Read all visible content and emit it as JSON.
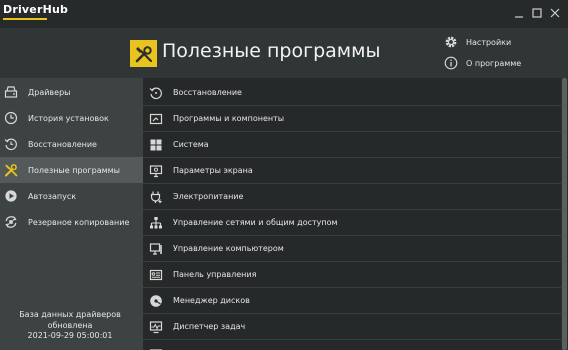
{
  "app": {
    "title": "DriverHub"
  },
  "header": {
    "title": "Полезные программы",
    "settings_label": "Настройки",
    "about_label": "О программе"
  },
  "sidebar": {
    "items": [
      {
        "label": "Драйверы",
        "icon": "driver-icon"
      },
      {
        "label": "История установок",
        "icon": "history-icon"
      },
      {
        "label": "Восстановление",
        "icon": "restore-icon"
      },
      {
        "label": "Полезные программы",
        "icon": "tools-icon",
        "active": true
      },
      {
        "label": "Автозапуск",
        "icon": "autorun-icon"
      },
      {
        "label": "Резервное копирование",
        "icon": "backup-icon"
      }
    ],
    "status": {
      "line1": "База данных драйверов",
      "line2": "обновлена",
      "timestamp": "2021-09-29 05:00:01"
    }
  },
  "main": {
    "items": [
      {
        "label": "Восстановление",
        "icon": "restore-icon"
      },
      {
        "label": "Программы и компоненты",
        "icon": "programs-icon"
      },
      {
        "label": "Система",
        "icon": "windows-icon"
      },
      {
        "label": "Параметры экрана",
        "icon": "display-icon"
      },
      {
        "label": "Электропитание",
        "icon": "power-icon"
      },
      {
        "label": "Управление сетями и общим доступом",
        "icon": "network-icon"
      },
      {
        "label": "Управление компьютером",
        "icon": "computer-icon"
      },
      {
        "label": "Панель управления",
        "icon": "control-panel-icon"
      },
      {
        "label": "Менеджер дисков",
        "icon": "disk-icon"
      },
      {
        "label": "Диспетчер задач",
        "icon": "task-manager-icon"
      }
    ]
  },
  "colors": {
    "accent": "#e9c31e",
    "sidebar_bg": "#3d4242",
    "main_bg": "#262929",
    "active_bg": "#545959"
  }
}
